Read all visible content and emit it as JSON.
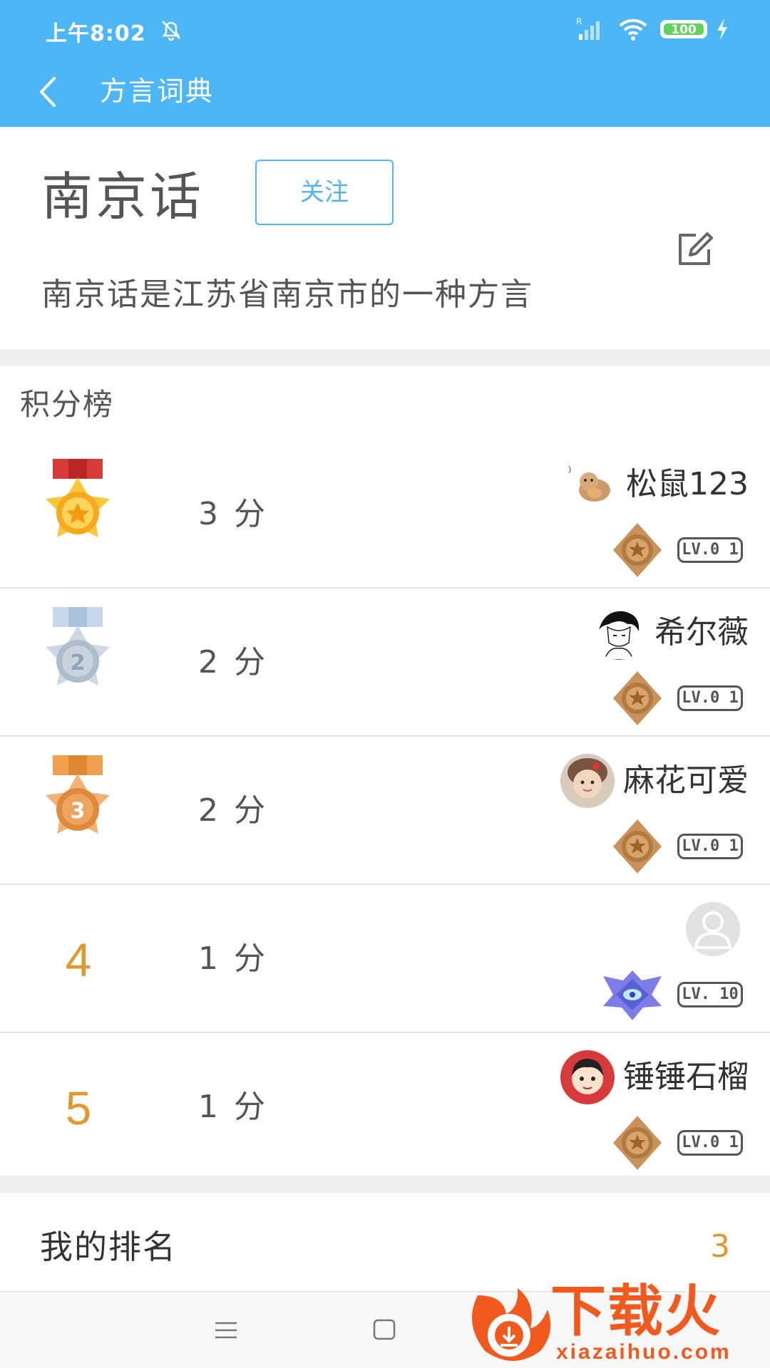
{
  "status_bar": {
    "time": "上午8:02",
    "battery": "100"
  },
  "app_bar": {
    "title": "方言词典"
  },
  "dialect": {
    "name": "南京话",
    "follow_label": "关注",
    "description": "南京话是江苏省南京市的一种方言"
  },
  "leaderboard": {
    "title": "积分榜",
    "rows": [
      {
        "rank": "1",
        "medal": "gold-medal",
        "score": "3 分",
        "username": "松鼠123",
        "level": "LV.0 1",
        "badge": "bronze-star-badge"
      },
      {
        "rank": "2",
        "medal": "silver-medal",
        "score": "2 分",
        "username": "希尔薇",
        "level": "LV.0 1",
        "badge": "bronze-star-badge"
      },
      {
        "rank": "3",
        "medal": "bronze-medal",
        "score": "2 分",
        "username": "麻花可爱",
        "level": "LV.0 1",
        "badge": "bronze-star-badge"
      },
      {
        "rank": "4",
        "medal": "",
        "score": "1 分",
        "username": "",
        "level": "LV. 10",
        "badge": "purple-diamond-badge"
      },
      {
        "rank": "5",
        "medal": "",
        "score": "1 分",
        "username": "锤锤石榴",
        "level": "LV.0 1",
        "badge": "bronze-star-badge"
      }
    ]
  },
  "my_rank": {
    "label": "我的排名",
    "value": "3"
  },
  "watermark": {
    "brand": "下载火",
    "url": "xiazaihuo.com"
  },
  "colors": {
    "primary": "#4cb6f6",
    "rank_accent": "#e0992e",
    "divider": "#efefef"
  }
}
